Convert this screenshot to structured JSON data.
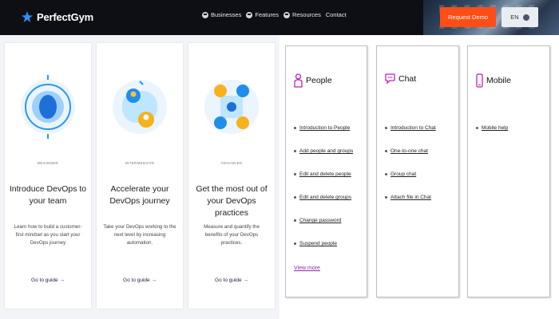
{
  "header": {
    "logo_text": "PerfectGym",
    "nav": [
      {
        "label": "Businesses",
        "icon": "chevron-circle-icon"
      },
      {
        "label": "Features",
        "icon": "chevron-circle-icon"
      },
      {
        "label": "Resources",
        "icon": "chevron-circle-icon"
      },
      {
        "label": "Contact",
        "icon": ""
      }
    ],
    "request_demo": "Request Demo",
    "language": "EN"
  },
  "cards": [
    {
      "level": "BEGINNER",
      "title": "Introduce DevOps to your team",
      "desc": "Learn how to build a customer-first mindset as you start your DevOps journey",
      "guide": "Go to guide →",
      "accent": "#1f8ee8"
    },
    {
      "level": "INTERMEDIATE",
      "title": "Accelerate your DevOps journey",
      "desc": "Take your DevOps working to the next level by increasing automation.",
      "guide": "Go to guide →",
      "accent": "#f5b21b"
    },
    {
      "level": "ADVANCED",
      "title": "Get the most out of your DevOps practices",
      "desc": "Measure and quantify the benefits of your DevOps practices.",
      "guide": "Go to guide →",
      "accent": "#1f8ee8"
    }
  ],
  "panels": [
    {
      "title": "People",
      "icon": "people-icon",
      "links": [
        "Introduction to People",
        "Add people and groups",
        "Edit and delete people",
        "Edit and delete groups",
        "Change password",
        "Suspend people"
      ],
      "view_more": "View more"
    },
    {
      "title": "Chat",
      "icon": "chat-icon",
      "links": [
        "Introduction to Chat",
        "One-to-one chat",
        "Group chat",
        "Attach file in Chat"
      ]
    },
    {
      "title": "Mobile",
      "icon": "mobile-icon",
      "links": [
        "Mobile help"
      ]
    }
  ],
  "colors": {
    "brand_accent": "#ff4d16",
    "panel_icon": "#c21fb0",
    "link_purple": "#8a2aa8"
  }
}
